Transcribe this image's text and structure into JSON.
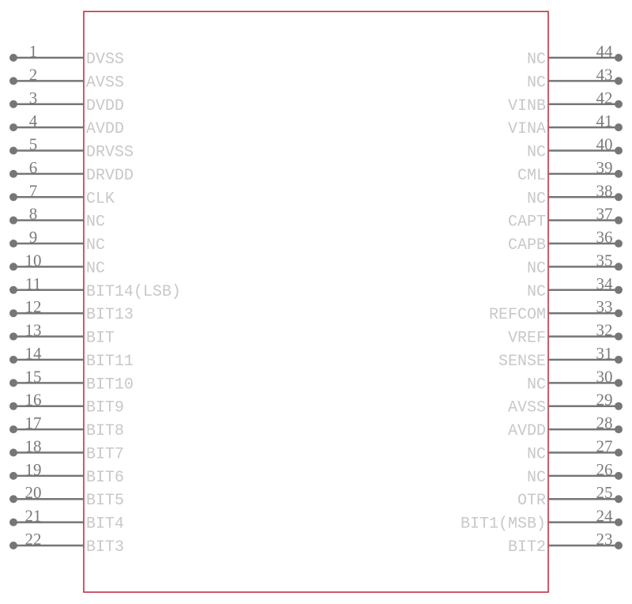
{
  "colors": {
    "body_outline": "#c0223a",
    "pin": "#767676",
    "pin_label": "#c8c8c8",
    "pin_number": "#7a7a7a"
  },
  "left_pins": [
    {
      "number": "1",
      "name": "DVSS"
    },
    {
      "number": "2",
      "name": "AVSS"
    },
    {
      "number": "3",
      "name": "DVDD"
    },
    {
      "number": "4",
      "name": "AVDD"
    },
    {
      "number": "5",
      "name": "DRVSS"
    },
    {
      "number": "6",
      "name": "DRVDD"
    },
    {
      "number": "7",
      "name": "CLK"
    },
    {
      "number": "8",
      "name": "NC"
    },
    {
      "number": "9",
      "name": "NC"
    },
    {
      "number": "10",
      "name": "NC"
    },
    {
      "number": "11",
      "name": "BIT14(LSB)"
    },
    {
      "number": "12",
      "name": "BIT13"
    },
    {
      "number": "13",
      "name": "BIT"
    },
    {
      "number": "14",
      "name": "BIT11"
    },
    {
      "number": "15",
      "name": "BIT10"
    },
    {
      "number": "16",
      "name": "BIT9"
    },
    {
      "number": "17",
      "name": "BIT8"
    },
    {
      "number": "18",
      "name": "BIT7"
    },
    {
      "number": "19",
      "name": "BIT6"
    },
    {
      "number": "20",
      "name": "BIT5"
    },
    {
      "number": "21",
      "name": "BIT4"
    },
    {
      "number": "22",
      "name": "BIT3"
    }
  ],
  "right_pins": [
    {
      "number": "44",
      "name": "NC"
    },
    {
      "number": "43",
      "name": "NC"
    },
    {
      "number": "42",
      "name": "VINB"
    },
    {
      "number": "41",
      "name": "VINA"
    },
    {
      "number": "40",
      "name": "NC"
    },
    {
      "number": "39",
      "name": "CML"
    },
    {
      "number": "38",
      "name": "NC"
    },
    {
      "number": "37",
      "name": "CAPT"
    },
    {
      "number": "36",
      "name": "CAPB"
    },
    {
      "number": "35",
      "name": "NC"
    },
    {
      "number": "34",
      "name": "NC"
    },
    {
      "number": "33",
      "name": "REFCOM"
    },
    {
      "number": "32",
      "name": "VREF"
    },
    {
      "number": "31",
      "name": "SENSE"
    },
    {
      "number": "30",
      "name": "NC"
    },
    {
      "number": "29",
      "name": "AVSS"
    },
    {
      "number": "28",
      "name": "AVDD"
    },
    {
      "number": "27",
      "name": "NC"
    },
    {
      "number": "26",
      "name": "NC"
    },
    {
      "number": "25",
      "name": "OTR"
    },
    {
      "number": "24",
      "name": "BIT1(MSB)"
    },
    {
      "number": "23",
      "name": "BIT2"
    }
  ]
}
